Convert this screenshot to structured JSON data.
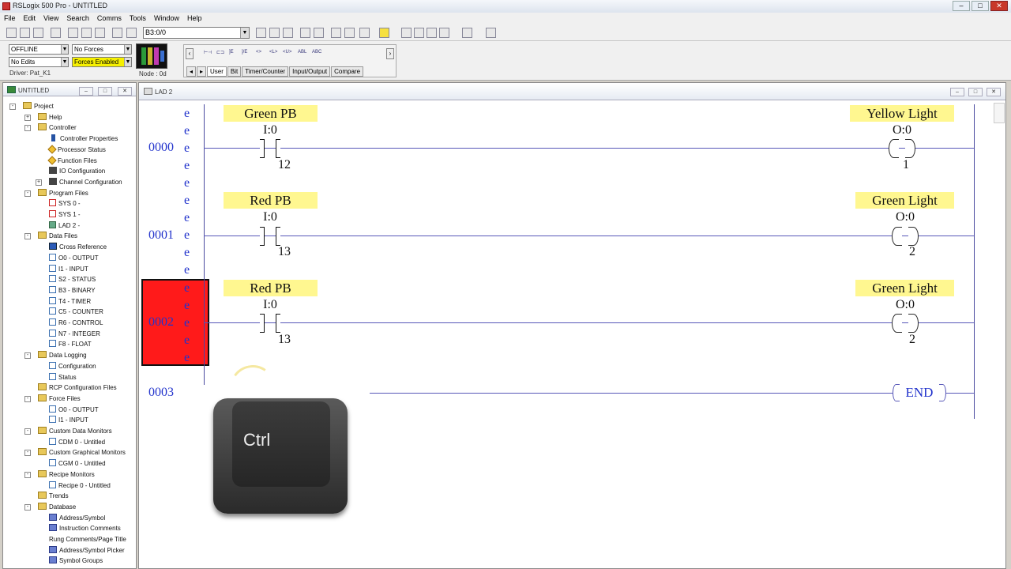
{
  "window": {
    "title": "RSLogix 500 Pro - UNTITLED"
  },
  "menu": [
    "File",
    "Edit",
    "View",
    "Search",
    "Comms",
    "Tools",
    "Window",
    "Help"
  ],
  "toolbar": {
    "address_value": "B3:0/0"
  },
  "status": {
    "mode": "OFFLINE",
    "forces": "No Forces",
    "edits": "No Edits",
    "forces_enabled": "Forces Enabled",
    "driver": "Driver: Pat_K1",
    "node": "Node : 0d"
  },
  "instruction_tabs": [
    "User",
    "Bit",
    "Timer/Counter",
    "Input/Output",
    "Compare"
  ],
  "project_panel": {
    "title": "UNTITLED",
    "tree": [
      {
        "label": "Project",
        "level": 0,
        "icon": "folder",
        "pm": "-"
      },
      {
        "label": "Help",
        "level": 1,
        "icon": "folder",
        "pm": "+"
      },
      {
        "label": "Controller",
        "level": 1,
        "icon": "folder",
        "pm": "-"
      },
      {
        "label": "Controller Properties",
        "level": 2,
        "icon": "info"
      },
      {
        "label": "Processor Status",
        "level": 2,
        "icon": "tri"
      },
      {
        "label": "Function Files",
        "level": 2,
        "icon": "tri"
      },
      {
        "label": "IO Configuration",
        "level": 2,
        "icon": "io"
      },
      {
        "label": "Channel Configuration",
        "level": 2,
        "icon": "io",
        "pm": "+"
      },
      {
        "label": "Program Files",
        "level": 1,
        "icon": "folder",
        "pm": "-"
      },
      {
        "label": "SYS 0 -",
        "level": 2,
        "icon": "red"
      },
      {
        "label": "SYS 1 -",
        "level": 2,
        "icon": "red"
      },
      {
        "label": "LAD 2 -",
        "level": 2,
        "icon": "ladder"
      },
      {
        "label": "Data Files",
        "level": 1,
        "icon": "folder",
        "pm": "-"
      },
      {
        "label": "Cross Reference",
        "level": 2,
        "icon": "xref"
      },
      {
        "label": "O0 - OUTPUT",
        "level": 2,
        "icon": "file"
      },
      {
        "label": "I1 - INPUT",
        "level": 2,
        "icon": "file"
      },
      {
        "label": "S2 - STATUS",
        "level": 2,
        "icon": "file"
      },
      {
        "label": "B3 - BINARY",
        "level": 2,
        "icon": "file"
      },
      {
        "label": "T4 - TIMER",
        "level": 2,
        "icon": "file"
      },
      {
        "label": "C5 - COUNTER",
        "level": 2,
        "icon": "file"
      },
      {
        "label": "R6 - CONTROL",
        "level": 2,
        "icon": "file"
      },
      {
        "label": "N7 - INTEGER",
        "level": 2,
        "icon": "file"
      },
      {
        "label": "F8 - FLOAT",
        "level": 2,
        "icon": "file"
      },
      {
        "label": "Data Logging",
        "level": 1,
        "icon": "folder",
        "pm": "-"
      },
      {
        "label": "Configuration",
        "level": 2,
        "icon": "file"
      },
      {
        "label": "Status",
        "level": 2,
        "icon": "file"
      },
      {
        "label": "RCP Configuration Files",
        "level": 1,
        "icon": "folder"
      },
      {
        "label": "Force Files",
        "level": 1,
        "icon": "folder",
        "pm": "-"
      },
      {
        "label": "O0 - OUTPUT",
        "level": 2,
        "icon": "file"
      },
      {
        "label": "I1 - INPUT",
        "level": 2,
        "icon": "file"
      },
      {
        "label": "Custom Data Monitors",
        "level": 1,
        "icon": "folder",
        "pm": "-"
      },
      {
        "label": "CDM 0 - Untitled",
        "level": 2,
        "icon": "file"
      },
      {
        "label": "Custom Graphical Monitors",
        "level": 1,
        "icon": "folder",
        "pm": "-"
      },
      {
        "label": "CGM 0 - Untitled",
        "level": 2,
        "icon": "file"
      },
      {
        "label": "Recipe Monitors",
        "level": 1,
        "icon": "folder",
        "pm": "-"
      },
      {
        "label": "Recipe 0 - Untitled",
        "level": 2,
        "icon": "file"
      },
      {
        "label": "Trends",
        "level": 1,
        "icon": "folder"
      },
      {
        "label": "Database",
        "level": 1,
        "icon": "folder",
        "pm": "-"
      },
      {
        "label": "Address/Symbol",
        "level": 2,
        "icon": "db"
      },
      {
        "label": "Instruction Comments",
        "level": 2,
        "icon": "db"
      },
      {
        "label": "Rung Comments/Page Title",
        "level": 2,
        "icon": "rung"
      },
      {
        "label": "Address/Symbol Picker",
        "level": 2,
        "icon": "db"
      },
      {
        "label": "Symbol Groups",
        "level": 2,
        "icon": "db"
      }
    ]
  },
  "ladder": {
    "title": "LAD 2",
    "rungs": [
      {
        "number": "0000",
        "input_tag": "Green PB",
        "input_addr": "I:0",
        "input_bit": "12",
        "output_tag": "Yellow Light",
        "output_addr": "O:0",
        "output_bit": "1"
      },
      {
        "number": "0001",
        "input_tag": "Red PB",
        "input_addr": "I:0",
        "input_bit": "13",
        "output_tag": "Green Light",
        "output_addr": "O:0",
        "output_bit": "2"
      },
      {
        "number": "0002",
        "input_tag": "Red PB",
        "input_addr": "I:0",
        "input_bit": "13",
        "output_tag": "Green Light",
        "output_addr": "O:0",
        "output_bit": "2"
      }
    ],
    "end_rung": {
      "number": "0003",
      "label": "END"
    },
    "e_marker": "e"
  },
  "overlay": {
    "key_label": "Ctrl"
  }
}
